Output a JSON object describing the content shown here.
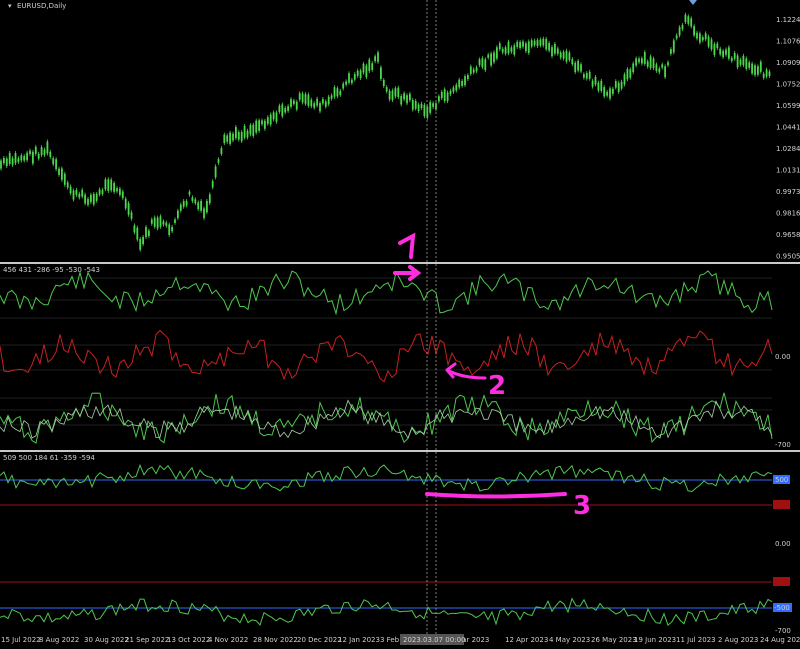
{
  "window": {
    "symbol_title": "EURUSD,Daily"
  },
  "price_axis": {
    "labels": [
      "1.12245",
      "1.10765",
      "1.09090",
      "1.07520",
      "1.05990",
      "1.04415",
      "1.02840",
      "1.01310",
      "0.99730",
      "0.98160",
      "0.96585",
      "0.95055"
    ]
  },
  "indicator1": {
    "header": "456 431 -286 -95 -530 -543",
    "axis_labels": [
      "0.00",
      "-700"
    ]
  },
  "indicator2": {
    "header": "509 500 184 61 -359 -594",
    "axis_labels": [
      "0.00",
      "-700"
    ],
    "level_badges": [
      "500",
      "-500"
    ]
  },
  "time_axis": {
    "labels": [
      "15 Jul 2022",
      "8 Aug 2022",
      "30 Aug 2022",
      "21 Sep 2022",
      "13 Oct 2022",
      "4 Nov 2022",
      "28 Nov 2022",
      "20 Dec 2022",
      "12 Jan 2023",
      "3 Feb 2023",
      "21 Mar 2023",
      "12 Apr 2023",
      "4 May 2023",
      "26 May 2023",
      "19 Jun 2023",
      "11 Jul 2023",
      "2 Aug 2023",
      "24 Aug 2023"
    ],
    "crosshair_label": "2023.03.07 00:00"
  },
  "annotations": {
    "labels": [
      "1",
      "2",
      "3"
    ]
  },
  "colors": {
    "background": "#000000",
    "candles": "#4cd84c",
    "indicator_green": "#4ec84e",
    "indicator_red": "#c82020",
    "blue_level": "#2f6cff",
    "red_level": "#a01010",
    "annotation": "#ff2de0",
    "separator": "#c8c8c8"
  }
}
